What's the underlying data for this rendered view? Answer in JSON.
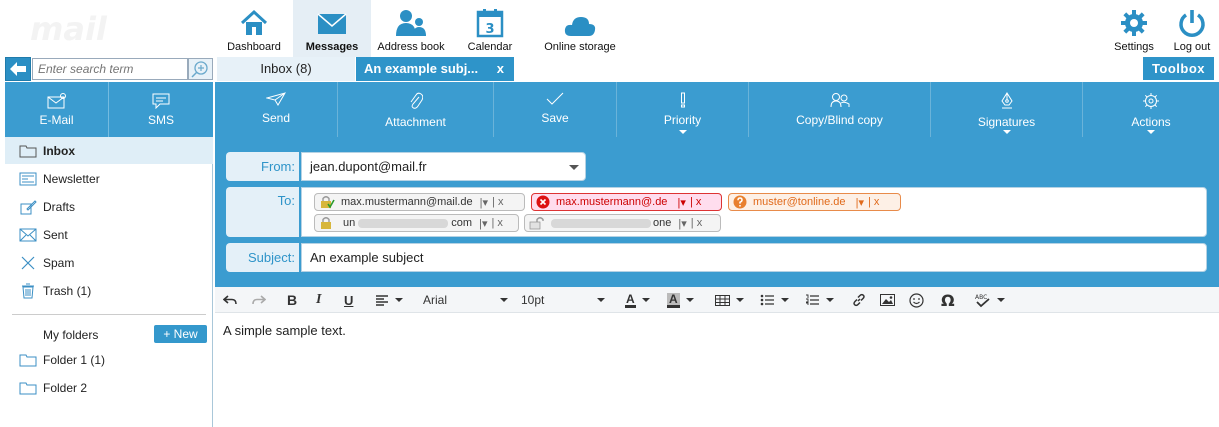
{
  "app": {
    "logo_text": "mail"
  },
  "nav": {
    "items": [
      {
        "label": "Dashboard",
        "icon": "home-icon"
      },
      {
        "label": "Messages",
        "icon": "envelope-icon"
      },
      {
        "label": "Address book",
        "icon": "contacts-icon"
      },
      {
        "label": "Calendar",
        "icon": "calendar-icon",
        "badge": "3"
      },
      {
        "label": "Online storage",
        "icon": "cloud-icon"
      },
      {
        "label": "Settings",
        "icon": "gear-icon"
      },
      {
        "label": "Log out",
        "icon": "power-icon"
      }
    ],
    "active": "Messages"
  },
  "search": {
    "placeholder": "Enter search term"
  },
  "tabs": [
    {
      "label": "Inbox (8)"
    },
    {
      "label": "An example subj...",
      "close": "x"
    }
  ],
  "toolbox": {
    "label": "Toolbox"
  },
  "sidebar": {
    "tabs": [
      {
        "label": "E-Mail"
      },
      {
        "label": "SMS"
      }
    ],
    "folders": [
      {
        "label": "Inbox",
        "icon": "inbox-icon"
      },
      {
        "label": "Newsletter",
        "icon": "newsletter-icon"
      },
      {
        "label": "Drafts",
        "icon": "drafts-icon"
      },
      {
        "label": "Sent",
        "icon": "sent-icon"
      },
      {
        "label": "Spam",
        "icon": "spam-icon"
      },
      {
        "label": "Trash (1)",
        "icon": "trash-icon"
      }
    ],
    "my_folders_label": "My folders",
    "new_label": "+ New",
    "user_folders": [
      {
        "label": "Folder 1 (1)"
      },
      {
        "label": "Folder 2"
      }
    ]
  },
  "toolbar": {
    "buttons": [
      {
        "label": "Send"
      },
      {
        "label": "Attachment"
      },
      {
        "label": "Save"
      },
      {
        "label": "Priority"
      },
      {
        "label": "Copy/Blind copy"
      },
      {
        "label": "Signatures"
      },
      {
        "label": "Actions"
      }
    ]
  },
  "compose": {
    "from_label": "From:",
    "from_value": "jean.dupont@mail.fr",
    "to_label": "To:",
    "recipients": [
      {
        "text": "max.mustermann@mail.de",
        "status": "secure"
      },
      {
        "text": "max.mustermann@.de",
        "status": "error"
      },
      {
        "text": "muster@tonline.de",
        "status": "unknown"
      },
      {
        "text_start": "un",
        "text_end": "com",
        "status": "locked"
      },
      {
        "text_end": "one",
        "status": "unlocked"
      }
    ],
    "chip_controls": "| x",
    "subject_label": "Subject:",
    "subject_value": "An example subject"
  },
  "editor": {
    "font": "Arial",
    "size": "10pt",
    "body": "A simple sample text."
  },
  "colors": {
    "accent": "#3b9cd0",
    "tab_active": "#2e94c9",
    "error": "#cc0000",
    "warning": "#e06a1b"
  }
}
